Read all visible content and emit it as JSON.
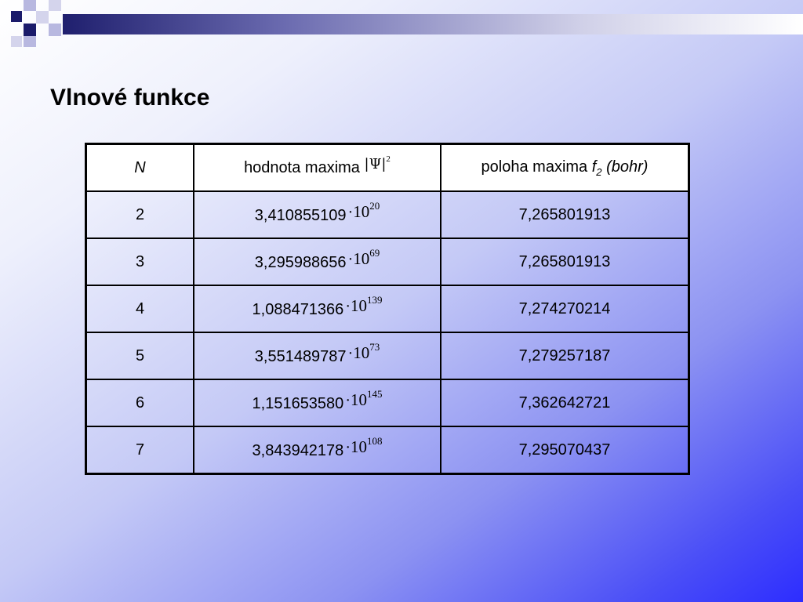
{
  "title": "Vlnové funkce",
  "table": {
    "headers": {
      "n": "N",
      "value_prefix": "hodnota maxima",
      "psi_symbol": "|Ψ|",
      "psi_power": "2",
      "position_prefix": "poloha maxima",
      "position_var": "f",
      "position_sub": "2",
      "position_unit": "(bohr)"
    },
    "multiply_symbol": "·",
    "base": "10",
    "rows": [
      {
        "n": "2",
        "mantissa": "3,410855109",
        "exponent": "20",
        "position": "7,265801913"
      },
      {
        "n": "3",
        "mantissa": "3,295988656",
        "exponent": "69",
        "position": "7,265801913"
      },
      {
        "n": "4",
        "mantissa": "1,088471366",
        "exponent": "139",
        "position": "7,274270214"
      },
      {
        "n": "5",
        "mantissa": "3,551489787",
        "exponent": "73",
        "position": "7,279257187"
      },
      {
        "n": "6",
        "mantissa": "1,151653580",
        "exponent": "145",
        "position": "7,362642721"
      },
      {
        "n": "7",
        "mantissa": "3,843942178",
        "exponent": "108",
        "position": "7,295070437"
      }
    ]
  }
}
